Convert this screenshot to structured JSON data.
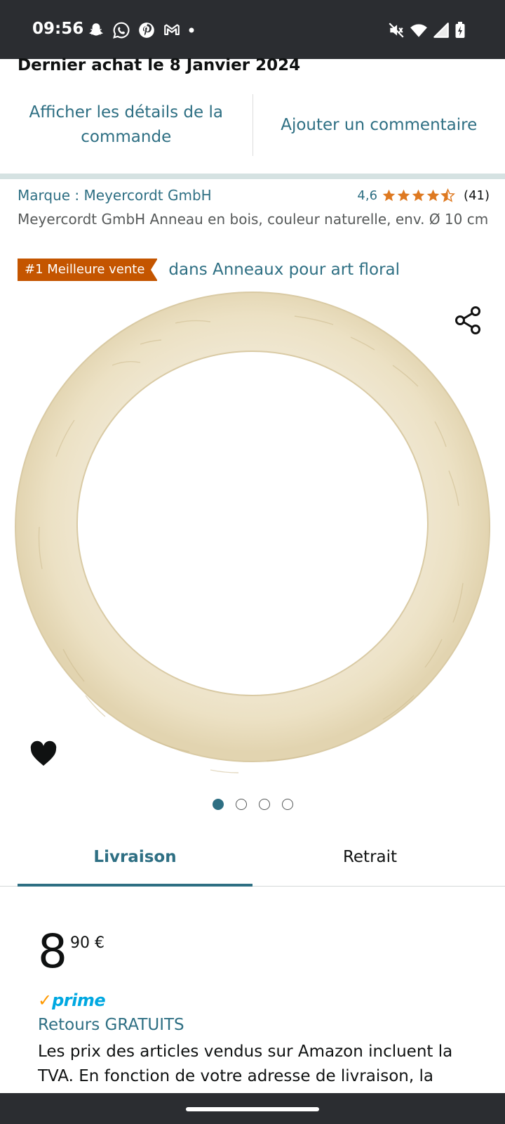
{
  "status_bar": {
    "time": "09:56",
    "left_icons": [
      "snapchat-icon",
      "whatsapp-icon",
      "pinterest-icon",
      "gmail-icon",
      "dot-icon"
    ],
    "right_icons": [
      "mute-icon",
      "wifi-icon",
      "signal-icon",
      "battery-icon"
    ]
  },
  "order": {
    "last_purchase": "Dernier achat le 8 Janvier 2024",
    "details_link": "Afficher les détails de la commande",
    "comment_link": "Ajouter un commentaire"
  },
  "product": {
    "brand": "Marque : Meyercordt GmbH",
    "rating_value": "4,6",
    "rating_stars": 4.6,
    "rating_count": "(41)",
    "title": "Meyercordt GmbH Anneau en bois, couleur naturelle, env. Ø 10 cm",
    "badge": "#1 Meilleure vente",
    "badge_category": "dans Anneaux pour art floral",
    "image_count": 4,
    "active_image": 1
  },
  "tabs": {
    "delivery": "Livraison",
    "pickup": "Retrait",
    "active": "delivery"
  },
  "pricing": {
    "whole": "8",
    "fraction": "90 €",
    "prime_check": "✓",
    "prime_word": "prime",
    "returns": "Retours GRATUITS",
    "vat_note": "Les prix des articles vendus sur Amazon incluent la TVA. En fonction de votre adresse de livraison, la"
  },
  "colors": {
    "link": "#2e6f83",
    "badge": "#c45500",
    "star": "#de7921",
    "prime_check": "#ff9900",
    "prime_word": "#00a8e1"
  }
}
